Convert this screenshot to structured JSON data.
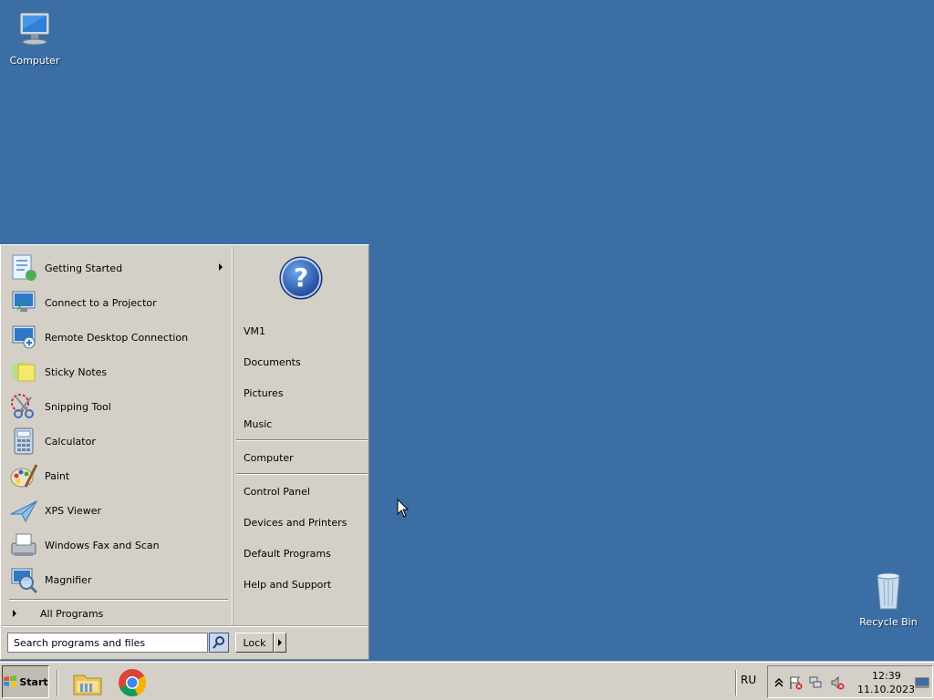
{
  "desktop": {
    "icons": [
      {
        "label": "Computer",
        "icon": "computer-icon"
      },
      {
        "label": "Recycle Bin",
        "icon": "recycle-bin-icon"
      }
    ]
  },
  "start_menu": {
    "programs": [
      {
        "label": "Getting Started",
        "icon": "getting-started-icon",
        "has_submenu": true
      },
      {
        "label": "Connect to a Projector",
        "icon": "projector-icon"
      },
      {
        "label": "Remote Desktop Connection",
        "icon": "remote-desktop-icon"
      },
      {
        "label": "Sticky Notes",
        "icon": "sticky-notes-icon"
      },
      {
        "label": "Snipping Tool",
        "icon": "snipping-tool-icon"
      },
      {
        "label": "Calculator",
        "icon": "calculator-icon"
      },
      {
        "label": "Paint",
        "icon": "paint-icon"
      },
      {
        "label": "XPS Viewer",
        "icon": "xps-viewer-icon"
      },
      {
        "label": "Windows Fax and Scan",
        "icon": "fax-scan-icon"
      },
      {
        "label": "Magnifier",
        "icon": "magnifier-icon"
      }
    ],
    "all_programs": "All Programs",
    "places": [
      {
        "label": "VM1"
      },
      {
        "label": "Documents"
      },
      {
        "label": "Pictures"
      },
      {
        "label": "Music"
      },
      {
        "label": "Computer"
      },
      {
        "label": "Control Panel"
      },
      {
        "label": "Devices and Printers"
      },
      {
        "label": "Default Programs"
      },
      {
        "label": "Help and Support"
      }
    ],
    "search_placeholder": "Search programs and files",
    "lock_label": "Lock"
  },
  "taskbar": {
    "start_label": "Start",
    "apps": [
      {
        "icon": "file-explorer-icon"
      },
      {
        "icon": "chrome-icon"
      }
    ],
    "language": "RU",
    "clock": {
      "time": "12:39",
      "date": "11.10.2023"
    }
  },
  "colors": {
    "desktop": "#3a6ea5",
    "menu_face": "#d4d0c8"
  }
}
